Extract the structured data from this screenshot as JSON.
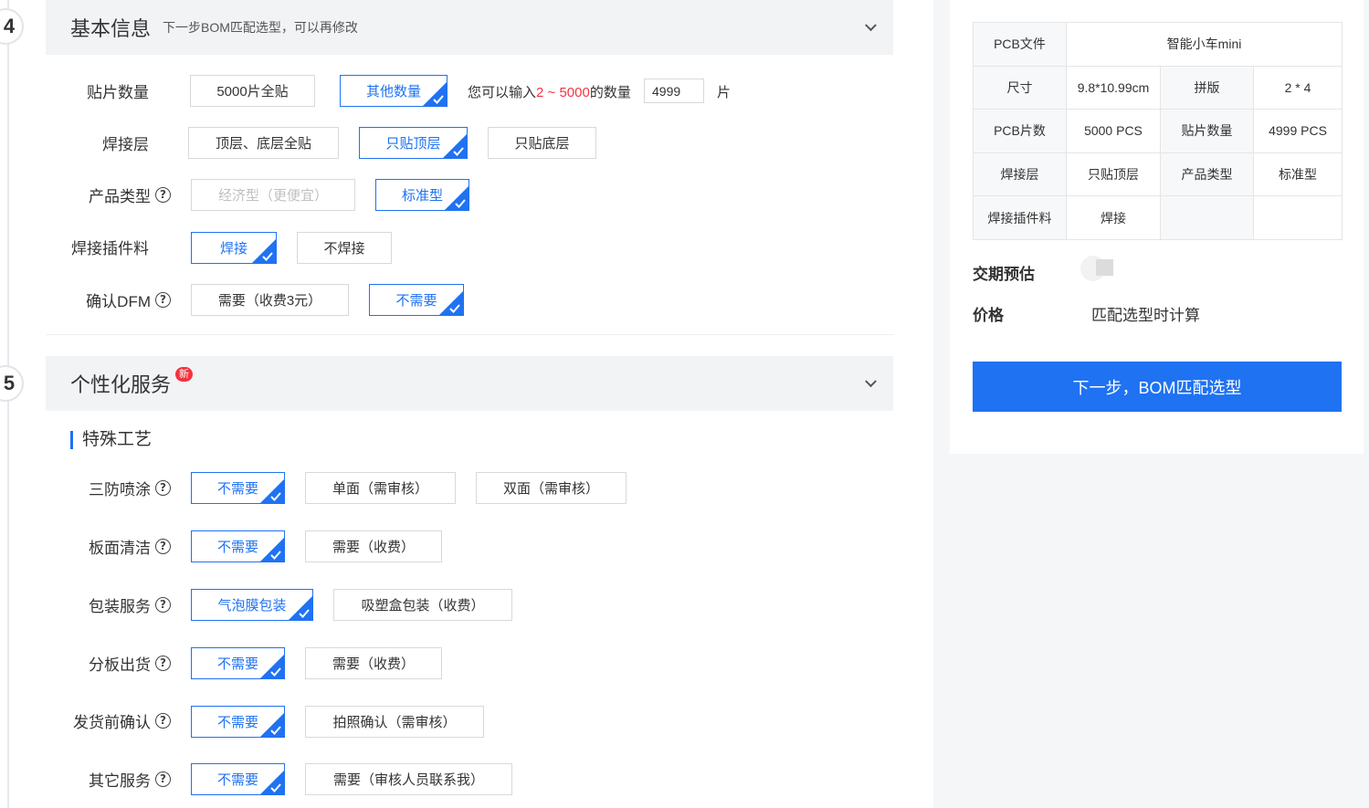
{
  "colors": {
    "accent": "#1f72f2",
    "danger": "#f5333f",
    "header_bg": "#f2f3f5"
  },
  "step4": {
    "number": "4",
    "title": "基本信息",
    "subtitle": "下一步BOM匹配选型，可以再修改",
    "mount_qty": {
      "label": "贴片数量",
      "options": [
        "5000片全贴",
        "其他数量"
      ],
      "hint_prefix": "您可以输入",
      "hint_range": "2 ~ 5000",
      "hint_suffix": "的数量",
      "value": "4999",
      "unit": "片"
    },
    "solder_layer": {
      "label": "焊接层",
      "options": [
        "顶层、底层全贴",
        "只贴顶层",
        "只贴底层"
      ]
    },
    "product_type": {
      "label": "产品类型",
      "options": [
        "经济型（更便宜）",
        "标准型"
      ]
    },
    "plugin": {
      "label": "焊接插件料",
      "options": [
        "焊接",
        "不焊接"
      ]
    },
    "dfm": {
      "label": "确认DFM",
      "options": [
        "需要（收费3元）",
        "不需要"
      ]
    }
  },
  "step5": {
    "number": "5",
    "title": "个性化服务",
    "badge": "新",
    "sub_title": "特殊工艺",
    "coating": {
      "label": "三防喷涂",
      "options": [
        "不需要",
        "单面（需审核）",
        "双面（需审核）"
      ]
    },
    "cleaning": {
      "label": "板面清洁",
      "options": [
        "不需要",
        "需要（收费）"
      ]
    },
    "packaging": {
      "label": "包装服务",
      "options": [
        "气泡膜包装",
        "吸塑盒包装（收费）"
      ]
    },
    "split": {
      "label": "分板出货",
      "options": [
        "不需要",
        "需要（收费）"
      ]
    },
    "confirm": {
      "label": "发货前确认",
      "options": [
        "不需要",
        "拍照确认（需审核）"
      ]
    },
    "other": {
      "label": "其它服务",
      "options": [
        "不需要",
        "需要（审核人员联系我）"
      ]
    }
  },
  "summary": {
    "pcb_file_k": "PCB文件",
    "pcb_file_v": "智能小车mini",
    "size_k": "尺寸",
    "size_v": "9.8*10.99cm",
    "panel_k": "拼版",
    "panel_v": "2 * 4",
    "pcb_qty_k": "PCB片数",
    "pcb_qty_v": "5000 PCS",
    "mount_k": "贴片数量",
    "mount_v": "4999 PCS",
    "layer_k": "焊接层",
    "layer_v": "只贴顶层",
    "type_k": "产品类型",
    "type_v": "标准型",
    "plugin_k": "焊接插件料",
    "plugin_v": "焊接",
    "lead_label": "交期预估",
    "price_label": "价格",
    "price_value": "匹配选型时计算",
    "next_button": "下一步，BOM匹配选型"
  }
}
